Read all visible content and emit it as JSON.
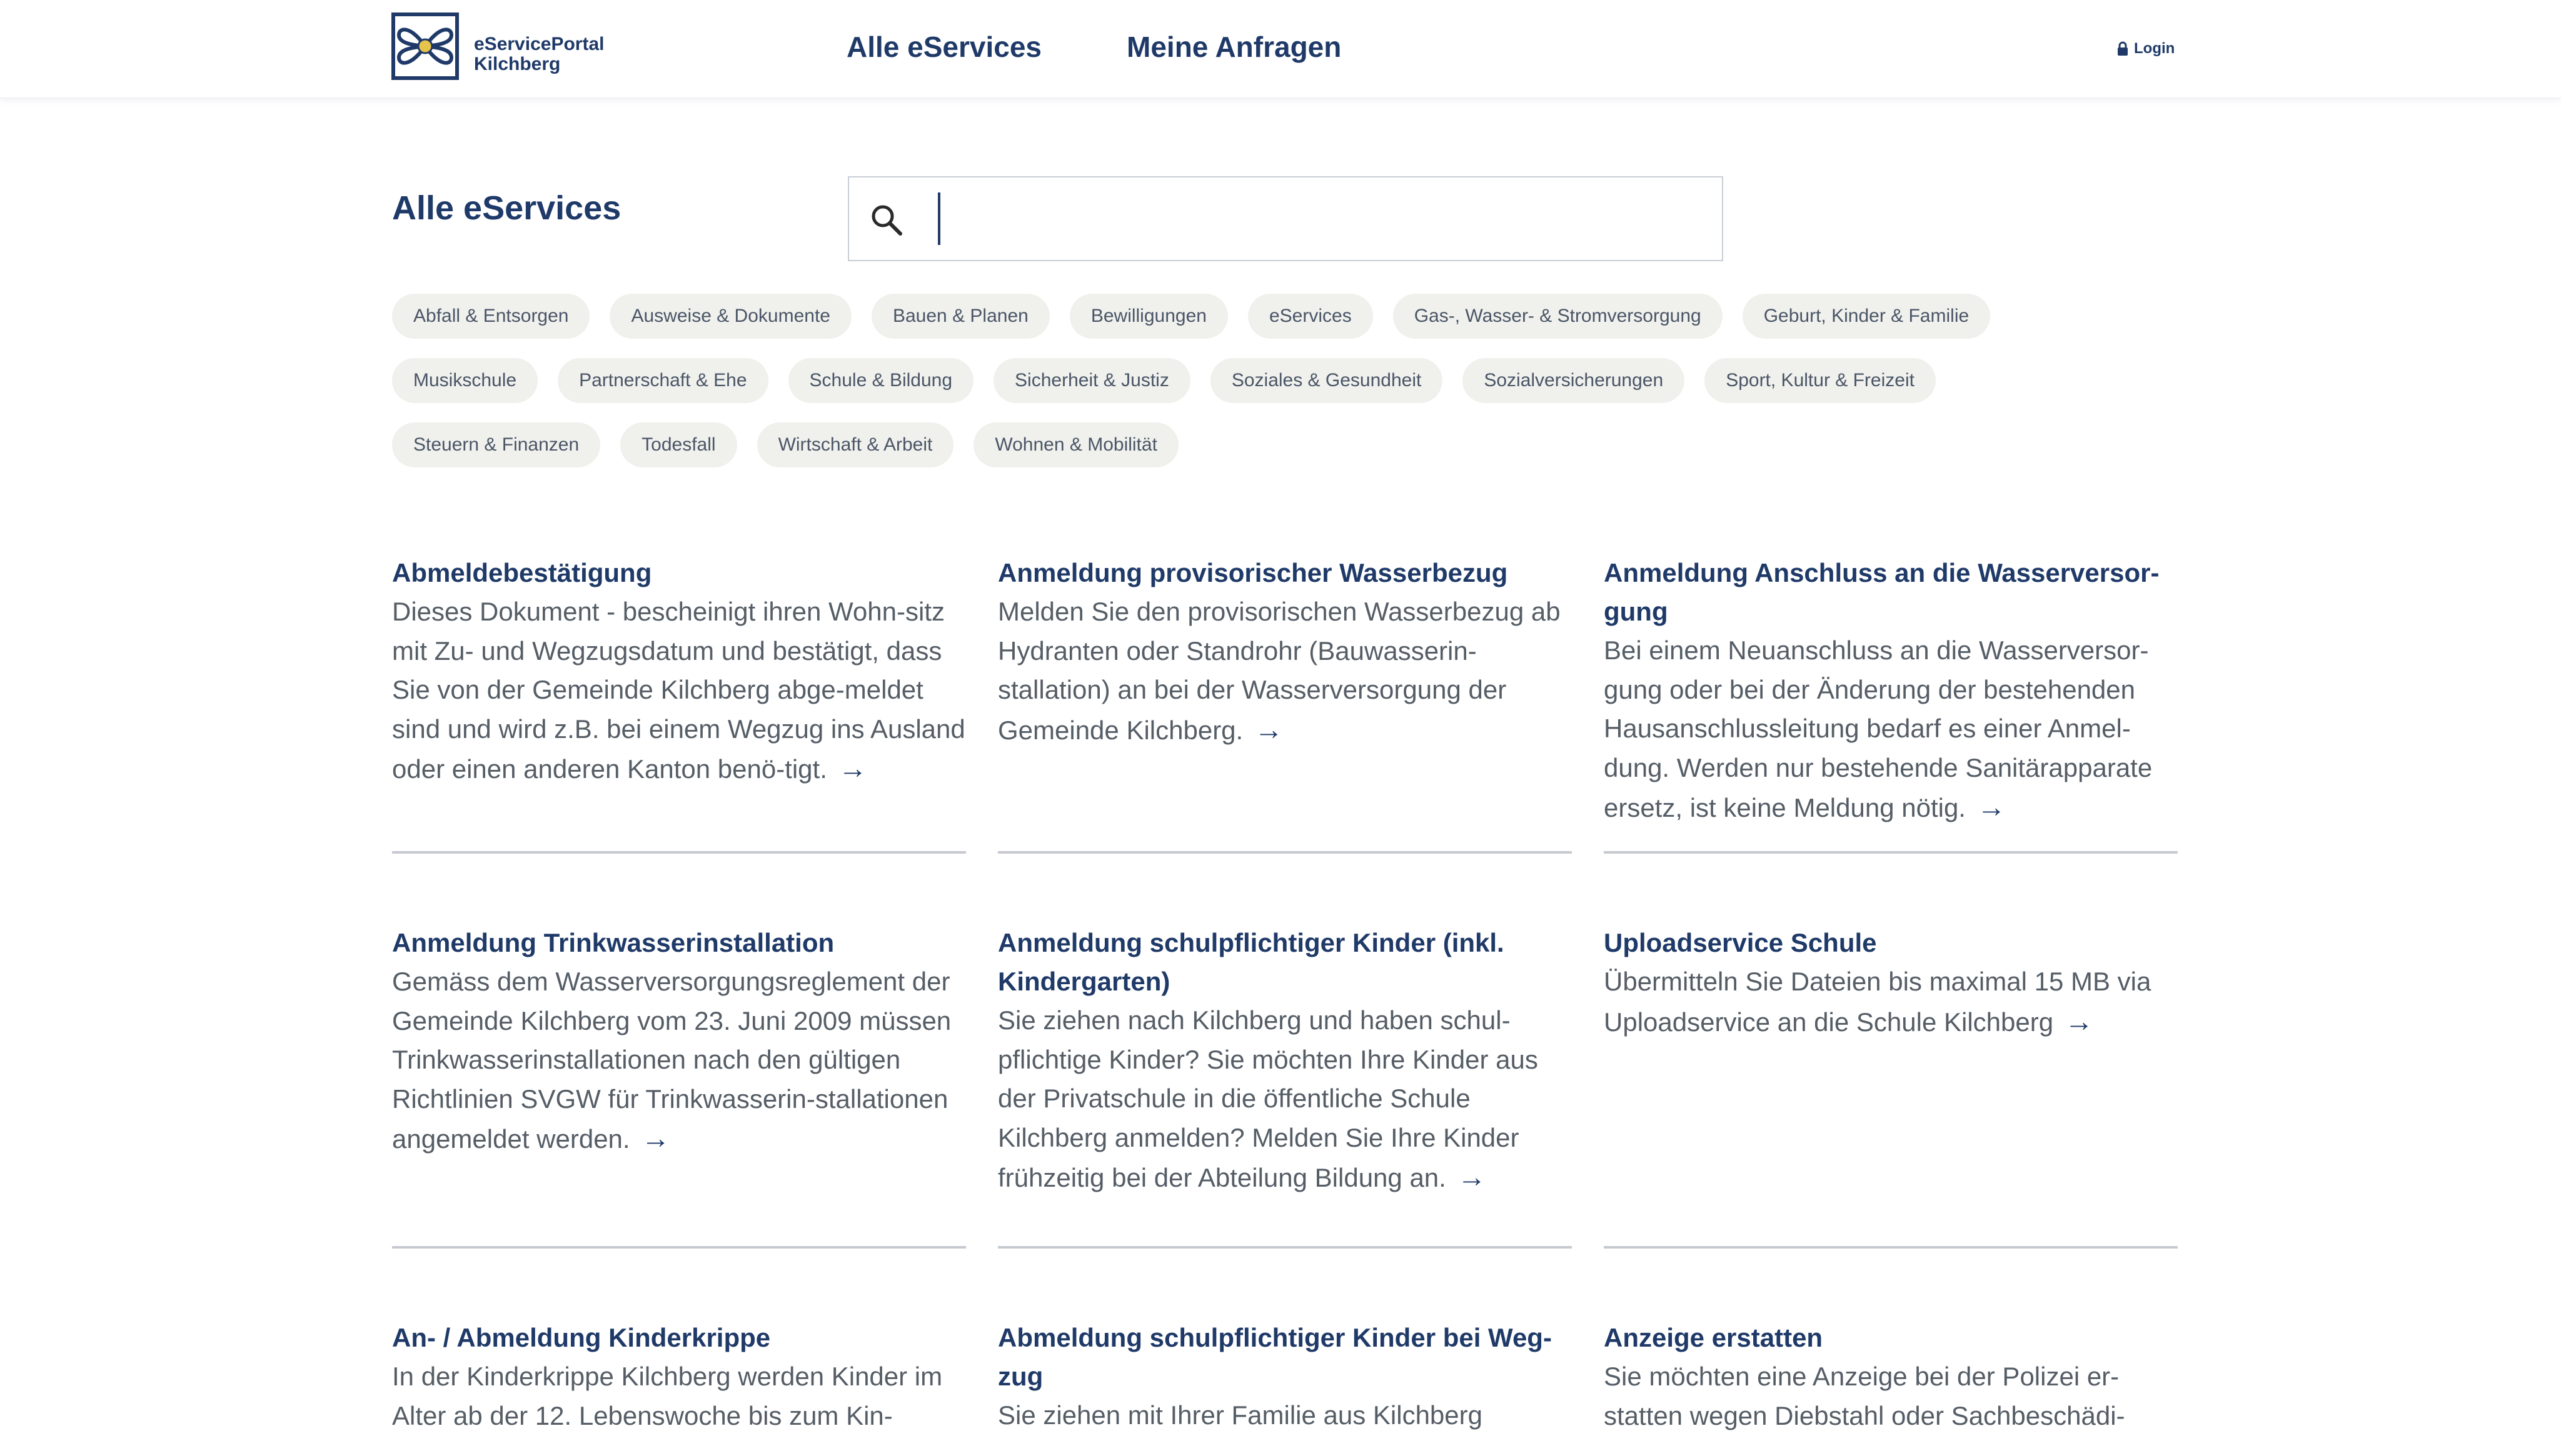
{
  "header": {
    "logo_line1": "eServicePortal",
    "logo_line2": "Kilchberg",
    "nav": [
      "Alle eServices",
      "Meine Anfragen"
    ],
    "login_label": "Login"
  },
  "main": {
    "title": "Alle eServices",
    "search": {
      "value": "",
      "placeholder": ""
    }
  },
  "categories": [
    [
      "Abfall & Entsorgen",
      "Ausweise & Dokumente",
      "Bauen & Planen",
      "Bewilligungen",
      "eServices",
      "Gas-, Wasser- & Stromversorgung",
      "Geburt, Kinder & Familie"
    ],
    [
      "Musikschule",
      "Partnerschaft & Ehe",
      "Schule & Bildung",
      "Sicherheit & Justiz",
      "Soziales & Gesundheit",
      "Sozialversicherungen",
      "Sport, Kultur & Freizeit"
    ],
    [
      "Steuern & Finanzen",
      "Todesfall",
      "Wirtschaft & Arbeit",
      "Wohnen & Mobilität"
    ]
  ],
  "services": [
    {
      "title": "Abmeldebestätigung",
      "desc": "Dieses Dokument - bescheinigt ihren Wohn-sitz mit Zu- und Wegzugsdatum und bestätigt, dass Sie von der Gemeinde Kilchberg abge-meldet sind und wird z.B. bei einem Wegzug ins Ausland oder einen anderen Kanton benö-tigt."
    },
    {
      "title": "Anmeldung provisorischer Wasserbezug",
      "desc": "Melden Sie den provisorischen Wasserbezug ab Hydranten oder Standrohr (Bauwasserin-stallation) an bei der Wasserversorgung der Gemeinde Kilchberg."
    },
    {
      "title": "Anmeldung Anschluss an die Wasserversor-gung",
      "desc": "Bei einem Neuanschluss an die Wasserversor-gung oder bei der Änderung der bestehenden Hausanschlussleitung bedarf es einer Anmel-dung. Werden nur bestehende Sanitärapparate ersetz, ist keine Meldung nötig."
    },
    {
      "title": "Anmeldung Trinkwasserinstallation",
      "desc": "Gemäss dem Wasserversorgungsreglement der Gemeinde Kilchberg vom 23. Juni 2009 müssen Trinkwasserinstallationen nach den gültigen Richtlinien SVGW für Trinkwasserin-stallationen angemeldet werden."
    },
    {
      "title": "Anmeldung schulpflichtiger Kinder (inkl. Kindergarten)",
      "desc": "Sie ziehen nach Kilchberg und haben schul-pflichtige Kinder? Sie möchten Ihre Kinder aus der Privatschule in die öffentliche Schule Kilchberg anmelden? Melden Sie Ihre Kinder frühzeitig bei der Abteilung Bildung an."
    },
    {
      "title": "Uploadservice Schule",
      "desc": "Übermitteln Sie Dateien bis maximal 15 MB via Uploadservice an die Schule Kilchberg"
    },
    {
      "title": "An- / Abmeldung Kinderkrippe",
      "desc": "In der Kinderkrippe Kilchberg werden Kinder im Alter ab der 12. Lebenswoche bis zum Kin-"
    },
    {
      "title": "Abmeldung schulpflichtiger Kinder bei Weg-zug",
      "desc": "Sie ziehen mit Ihrer Familie aus Kilchberg"
    },
    {
      "title": "Anzeige erstatten",
      "desc": "Sie möchten eine Anzeige bei der Polizei er-statten wegen Diebstahl oder Sachbeschädi-"
    }
  ],
  "arrow_glyph": "→",
  "colors": {
    "brand": "#1f3a68",
    "chip_bg": "#f0f1ed",
    "text": "#555d66",
    "divider": "#c6c9cf"
  }
}
